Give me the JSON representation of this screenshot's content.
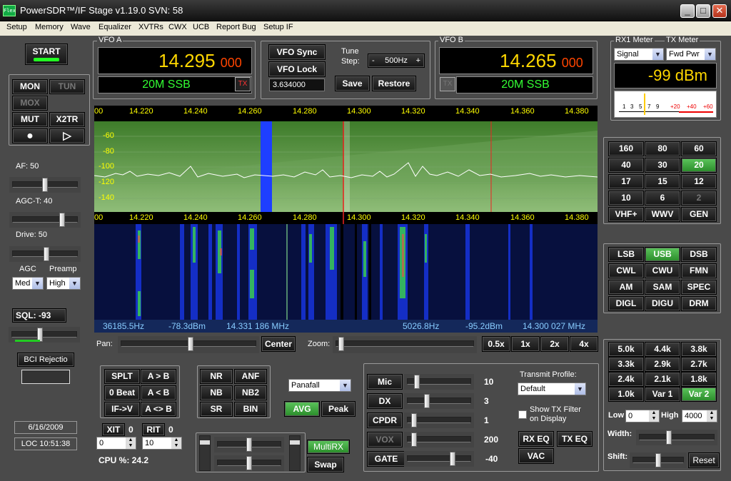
{
  "window": {
    "title": "PowerSDR™/IF Stage  v1.19.0  SVN: 58",
    "icon_text": "Flex",
    "min": "_",
    "max": "□",
    "close": "✕"
  },
  "menu": [
    "Setup",
    "Memory",
    "Wave",
    "Equalizer",
    "XVTRs",
    "CWX",
    "UCB",
    "Report Bug",
    "Setup IF"
  ],
  "left": {
    "start": "START",
    "mon": "MON",
    "tun": "TUN",
    "mox": "MOX",
    "mut": "MUT",
    "x2tr": "X2TR",
    "rec": "●",
    "play": "▷",
    "af": "AF:  50",
    "agct": "AGC-T:  40",
    "drive": "Drive:  50",
    "agc": "AGC",
    "preamp": "Preamp",
    "agc_val": "Med",
    "preamp_val": "High",
    "sql": "SQL:  -93",
    "bci": "BCI Rejectio",
    "date": "6/16/2009",
    "time": "LOC 10:51:38"
  },
  "vfoa": {
    "label": "VFO A",
    "freq_main": "14.295",
    "freq_sub": "000",
    "mode": "20M SSB",
    "tx": "TX"
  },
  "vfob": {
    "label": "VFO B",
    "freq_main": "14.265",
    "freq_sub": "000",
    "mode": "20M SSB",
    "tx": "TX"
  },
  "center": {
    "vfo_sync": "VFO Sync",
    "vfo_lock": "VFO Lock",
    "tune": "Tune",
    "step": "Step:",
    "step_minus": "-",
    "step_val": "500Hz",
    "step_plus": "+",
    "if_freq": "3.634000",
    "save": "Save",
    "restore": "Restore"
  },
  "meters": {
    "rx1": "RX1 Meter",
    "tx": "TX Meter",
    "rx_sel": "Signal",
    "tx_sel": "Fwd Pwr",
    "reading": "-99 dBm",
    "scale": [
      "1",
      "3",
      "5",
      "7",
      "9",
      "+20",
      "+40",
      "+60"
    ]
  },
  "display": {
    "ticks": [
      "00",
      "14.220",
      "14.240",
      "14.260",
      "14.280",
      "14.300",
      "14.320",
      "14.340",
      "14.360",
      "14.380"
    ],
    "db_labels": [
      "-60",
      "-80",
      "-100",
      "-120",
      "-140"
    ],
    "status_left": "36185.5Hz",
    "status_dbm_left": "-78.3dBm",
    "status_freq_left": "14.331 186 MHz",
    "status_right": "5026.8Hz",
    "status_dbm_right": "-95.2dBm",
    "status_freq_right": "14.300 027 MHz",
    "pan": "Pan:",
    "center_btn": "Center",
    "zoom": "Zoom:",
    "zoom_opts": [
      "0.5x",
      "1x",
      "2x",
      "4x"
    ]
  },
  "bands": [
    "160",
    "80",
    "60",
    "40",
    "30",
    "20",
    "17",
    "15",
    "12",
    "10",
    "6",
    "2",
    "VHF+",
    "WWV",
    "GEN"
  ],
  "band_active": "20",
  "modes": [
    "LSB",
    "USB",
    "DSB",
    "CWL",
    "CWU",
    "FMN",
    "AM",
    "SAM",
    "SPEC",
    "DIGL",
    "DIGU",
    "DRM"
  ],
  "mode_active": "USB",
  "filters": [
    "5.0k",
    "4.4k",
    "3.8k",
    "3.3k",
    "2.9k",
    "2.7k",
    "2.4k",
    "2.1k",
    "1.8k",
    "1.0k",
    "Var 1",
    "Var 2"
  ],
  "filter_active": "Var 2",
  "filter_ctrl": {
    "low": "Low",
    "low_val": "0",
    "high": "High",
    "high_val": "4000",
    "width": "Width:",
    "shift": "Shift:",
    "reset": "Reset"
  },
  "dsp": {
    "splt": "SPLT",
    "ab": "A > B",
    "zbeat": "0 Beat",
    "ba": "A < B",
    "ifv": "IF->V",
    "swapab": "A <> B",
    "xit": "XIT",
    "xit_n": "0",
    "xit_val": "0",
    "rit": "RIT",
    "rit_n": "0",
    "rit_val": "10",
    "cpu": "CPU %: 24.2",
    "nr": "NR",
    "anf": "ANF",
    "nb": "NB",
    "nb2": "NB2",
    "sr": "SR",
    "bin": "BIN",
    "display_mode": "Panafall",
    "avg": "AVG",
    "peak": "Peak",
    "multirx": "MultiRX",
    "swap": "Swap"
  },
  "tx": {
    "mic": "Mic",
    "mic_val": "10",
    "dx": "DX",
    "dx_val": "3",
    "cpdr": "CPDR",
    "cpdr_val": "1",
    "vox": "VOX",
    "vox_val": "200",
    "gate": "GATE",
    "gate_val": "-40",
    "profile_label": "Transmit Profile:",
    "profile": "Default",
    "show_tx": "Show TX Filter",
    "on_display": "on Display",
    "rxeq": "RX EQ",
    "txeq": "TX EQ",
    "vac": "VAC"
  }
}
